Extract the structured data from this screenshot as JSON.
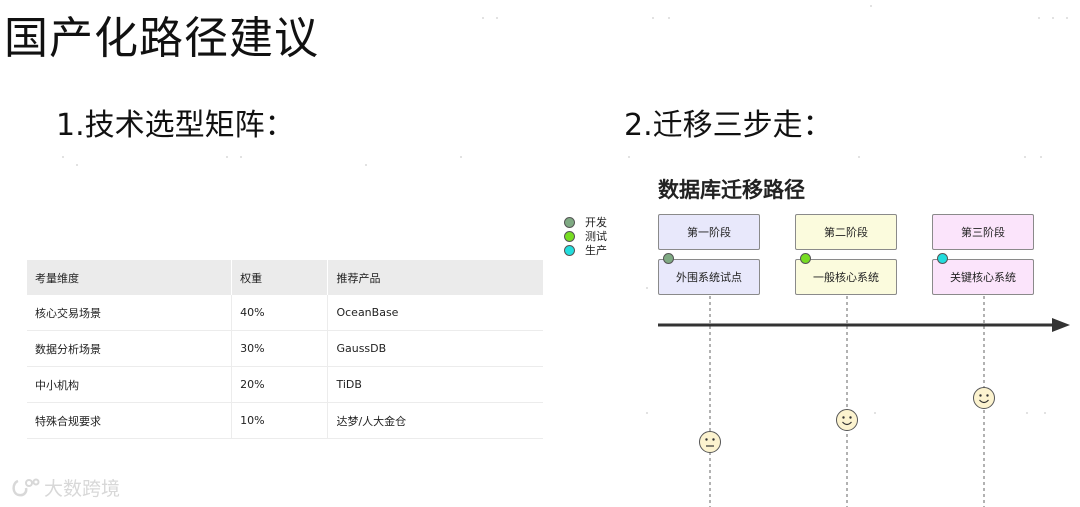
{
  "page": {
    "title": "国产化路径建议",
    "section1_title": "1.技术选型矩阵：",
    "section2_title": "2.迁移三步走："
  },
  "matrix": {
    "headers": [
      "考量维度",
      "权重",
      "推荐产品"
    ],
    "rows": [
      [
        "核心交易场景",
        "40%",
        "OceanBase"
      ],
      [
        "数据分析场景",
        "30%",
        "GaussDB"
      ],
      [
        "中小机构",
        "20%",
        "TiDB"
      ],
      [
        "特殊合规要求",
        "10%",
        "达梦/人大金仓"
      ]
    ]
  },
  "diagram": {
    "title": "数据库迁移路径",
    "legend": [
      {
        "label": "开发",
        "color": "#7faa83"
      },
      {
        "label": "测试",
        "color": "#77dd22"
      },
      {
        "label": "生产",
        "color": "#22dddd"
      }
    ],
    "phases": [
      {
        "label": "第一阶段",
        "system": "外围系统试点",
        "fill": "#e8e8fb",
        "dot": "#7faa83",
        "mood": "neutral"
      },
      {
        "label": "第二阶段",
        "system": "一般核心系统",
        "fill": "#fbfbdd",
        "dot": "#77dd22",
        "mood": "smile"
      },
      {
        "label": "第三阶段",
        "system": "关键核心系统",
        "fill": "#fbe4fb",
        "dot": "#22dddd",
        "mood": "smile"
      }
    ],
    "face_color": "#fcf3cf"
  },
  "watermark": "大数跨境"
}
